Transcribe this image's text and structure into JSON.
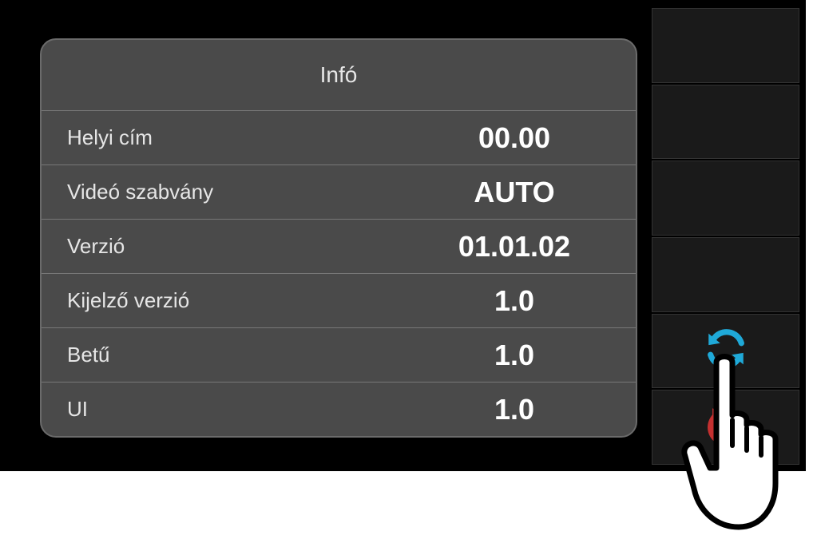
{
  "panel": {
    "title": "Infó",
    "rows": [
      {
        "label": "Helyi cím",
        "value": "00.00"
      },
      {
        "label": "Videó szabvány",
        "value": "AUTO"
      },
      {
        "label": "Verzió",
        "value": "01.01.02"
      },
      {
        "label": "Kijelző verzió",
        "value": "1.0"
      },
      {
        "label": "Betű",
        "value": "1.0"
      },
      {
        "label": "UI",
        "value": "1.0"
      }
    ]
  },
  "icons": {
    "refresh": "refresh-icon",
    "back": "back-icon"
  },
  "colors": {
    "refresh": "#1fa9d8",
    "back": "#c43030"
  }
}
